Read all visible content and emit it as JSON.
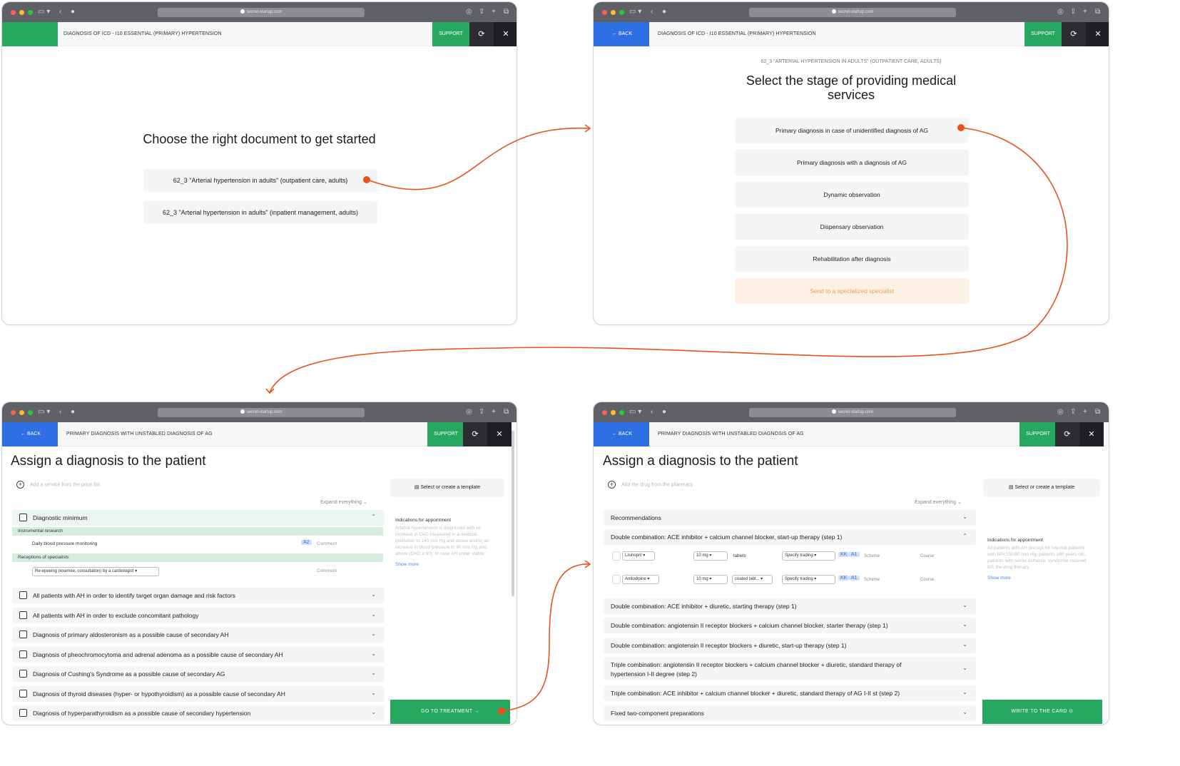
{
  "browser": {
    "url": "secret-startup.com"
  },
  "common": {
    "support": "SUPPORT",
    "back": "← BACK",
    "refresh_glyph": "⟳",
    "close_glyph": "✕"
  },
  "window1": {
    "header_title": "DIAGNOSIS OF ICD - I10 ESSENTIAL (PRIMARY) HYPERTENSION",
    "heading": "Choose the right document to get started",
    "documents": [
      "62_3 \"Arterial hypertension in adults\" (outpatient care, adults)",
      "62_3 \"Arterial hypertension in adults\" (inpatient management, adults)"
    ]
  },
  "window2": {
    "header_title": "DIAGNOSIS OF ICD - I10 ESSENTIAL (PRIMARY) HYPERTENSION",
    "overline": "62_3 \"ARTERIAL HYPERTENSION IN ADULTS\" (OUTPATIENT CARE, ADULTS)",
    "heading_line1": "Select the stage of providing medical",
    "heading_line2": "services",
    "stages": [
      "Primary diagnosis in case of unidentified diagnosis of AG",
      "Primary diagnosis with a diagnosis of AG",
      "Dynamic observation",
      "Dispensary observation",
      "Rehabilitation after diagnosis",
      "Send to a specialized specialist"
    ]
  },
  "window3": {
    "header_title": "PRIMARY DIAGNOSIS WITH UNSTABLED DIAGNOSIS OF AG",
    "heading": "Assign a diagnosis to the patient",
    "add_placeholder": "Add a service from the price list",
    "expand": "Expand everything",
    "template_button": "Select or create a template",
    "side_title": "Indications for appointment",
    "side_text": "Arterial hypertension is diagnosed with an increase in CAD measured in a medical institution to 140 mm Hg and above and/or an increase in blood pressure to 90 mm Hg and above (DAD ≥ 90). In case AH under stable",
    "show_more": "Show more",
    "open_group": "Diagnostic minimum",
    "subhead1": "Instrumental research",
    "sub_item1": "Daily blood pressure monitoring",
    "sub_item1_tag": "A2",
    "comment": "Comment",
    "subhead2": "Receptions of specialists",
    "sub_item2": "Re-epeeing (examee, consultation) by a cardiologist",
    "groups": [
      "All patients with AH in order to identify target organ damage and risk factors",
      "All patients with AH in order to exclude concomitant pathology",
      "Diagnosis of primary aldosteronism as a possible cause of secondary AH",
      "Diagnosis of pheochromocytoma and adrenal adenoma as a possible cause of secondary AH",
      "Diagnosis of Cushing's Syndrome as a possible cause of secondary AG",
      "Diagnosis of thyroid diseases (hyper- or hypothyroidism) as a possible cause of secondary AH",
      "Diagnosis of hyperparathyroidism as a possible cause of secondary hypertension"
    ],
    "cta": "GO TO TREATMENT →"
  },
  "window4": {
    "header_title": "PRIMARY DIAGNOSIS WITH UNSTABLED DIAGNOSIS OF AG",
    "heading": "Assign a diagnosis to the patient",
    "add_placeholder": "Add the drug from the pharmacy",
    "expand": "Expand everything",
    "template_button": "Select or create a template",
    "side_title": "Indications for appointment",
    "side_text": "All patients with AH (except for low-risk patients with BP<150/90 mm Hg, patients ≥80 years old, patients with senile asthenia, syndrome reduced BP, the drug therapy",
    "show_more": "Show more",
    "recommendations": "Recommendations",
    "open_group": "Double combination: ACE inhibitor + calcium channel blocker, start-up therapy (step 1)",
    "drugs": [
      {
        "name": "Lisinopril",
        "dose": "10 mg",
        "form": "tablets",
        "trading": "Specify trading",
        "tag1": "KK",
        "tag2": "A1",
        "scheme": "Scheme",
        "course": "Course"
      },
      {
        "name": "Amlodipine",
        "dose": "10 mg",
        "form": "coated tabl...",
        "trading": "Specify trading",
        "tag1": "KK",
        "tag2": "A1",
        "scheme": "Scheme",
        "course": "Course"
      }
    ],
    "groups": [
      "Double combination: ACE inhibitor + diuretic, starting therapy (step 1)",
      "Double combination: angiotensin II receptor blockers + calcium channel blocker, starter therapy (step 1)",
      "Double combination: angiotensin II receptor blockers + diuretic, start-up therapy (step 1)",
      "Triple combination: angiotensin II receptor blockers + calcium channel blocker + diuretic, standard therapy of",
      "Triple combination: ACE inhibitor + calcium channel blocker + diuretic, standard therapy of AG I-II st (step 2)",
      "Fixed two-component preparations"
    ],
    "group4_line2": "hypertension I-II degree (step 2)",
    "cta": "WRITE TO THE CARD ⊙"
  },
  "colors": {
    "accent_green": "#27a861",
    "accent_blue": "#2f6fe4",
    "flow_orange": "#e8531e",
    "highlight_peach": "#fdf1e6"
  }
}
